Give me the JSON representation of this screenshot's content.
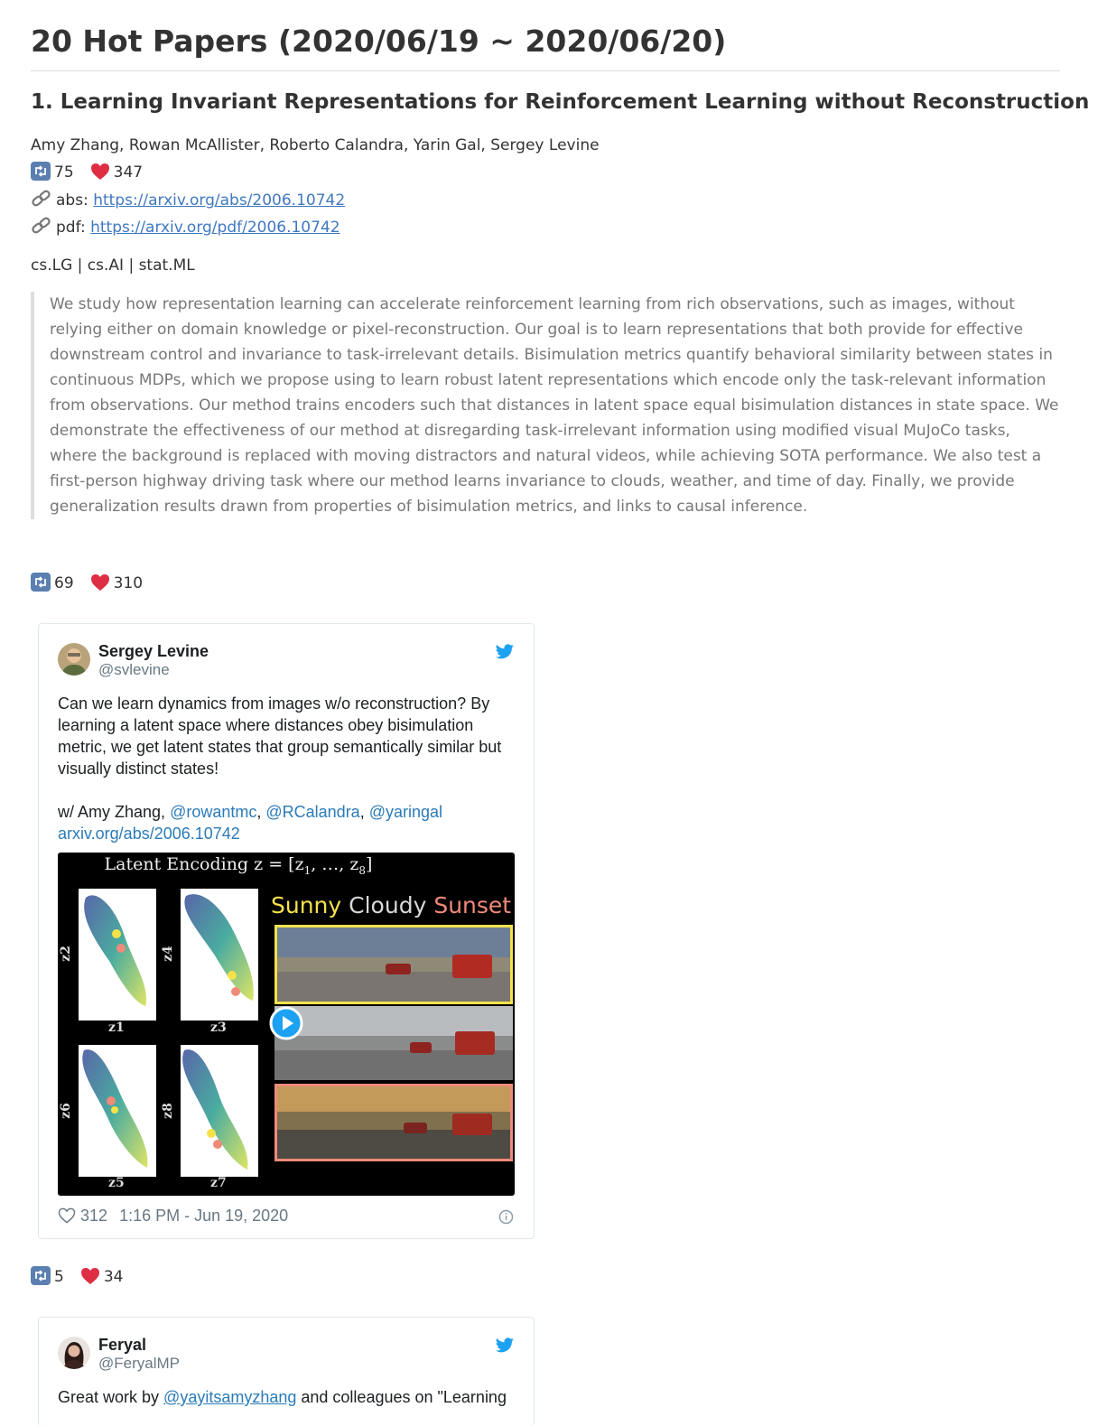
{
  "page_title": "20 Hot Papers (2020/06/19 ~ 2020/06/20)",
  "paper": {
    "title": "1. Learning Invariant Representations for Reinforcement Learning without  Reconstruction",
    "authors": "Amy Zhang, Rowan McAllister, Roberto Calandra, Yarin Gal, Sergey Levine",
    "retweets": "75",
    "likes": "347",
    "abs_label": "abs:",
    "abs_url": "https://arxiv.org/abs/2006.10742",
    "pdf_label": "pdf:",
    "pdf_url": "https://arxiv.org/pdf/2006.10742",
    "categories": "cs.LG | cs.AI | stat.ML",
    "abstract": "We study how representation learning can accelerate reinforcement learning from rich observations, such as images, without relying either on domain knowledge or pixel-reconstruction. Our goal is to learn representations that both provide for effective downstream control and invariance to task-irrelevant details. Bisimulation metrics quantify behavioral similarity between states in continuous MDPs, which we propose using to learn robust latent representations which encode only the task-relevant information from observations. Our method trains encoders such that distances in latent space equal bisimulation distances in state space. We demonstrate the effectiveness of our method at disregarding task-irrelevant information using modified visual MuJoCo tasks, where the background is replaced with moving distractors and natural videos, while achieving SOTA performance. We also test a first-person highway driving task where our method learns invariance to clouds, weather, and time of day. Finally, we provide generalization results drawn from properties of bisimulation metrics, and links to causal inference."
  },
  "tweet1": {
    "retweets": "69",
    "likes": "310",
    "name": "Sergey Levine",
    "handle": "@svlevine",
    "text": "Can we learn dynamics from images w/o reconstruction? By learning a latent space where distances obey bisimulation metric, we get latent states that group semantically similar but visually distinct states!",
    "mention_prefix": "w/ Amy Zhang, ",
    "mention1": "@rowantmc",
    "sep1": ", ",
    "mention2": "@RCalandra",
    "sep2": ", ",
    "mention3": "@yaringal",
    "link": "arxiv.org/abs/2006.10742",
    "media": {
      "title_prefix": "Latent Encoding ",
      "title_math": "z = [z",
      "title_sub1": "1",
      "title_mid": ", …, z",
      "title_sub2": "8",
      "title_end": "]",
      "word_sunny": "Sunny",
      "word_cloudy": "Cloudy",
      "word_sunset": "Sunset",
      "labels": [
        {
          "x": "z1",
          "y": "z2"
        },
        {
          "x": "z3",
          "y": "z4"
        },
        {
          "x": "z5",
          "y": "z6"
        },
        {
          "x": "z7",
          "y": "z8"
        }
      ],
      "colors": {
        "sunny": "#f5e24a",
        "cloudy": "#d8d8d8",
        "sunset": "#f08a7a"
      }
    },
    "like_count": "312",
    "timestamp": "1:16 PM - Jun 19, 2020"
  },
  "tweet2": {
    "retweets": "5",
    "likes": "34",
    "name": "Feryal",
    "handle": "@FeryalMP",
    "text_prefix": "Great work by ",
    "mention": "@yayitsamyzhang",
    "text_suffix": " and colleagues on \"Learning"
  },
  "colors": {
    "link": "#4078c0",
    "twitter_link": "#2b7bb9",
    "twitter_blue": "#1da1f2",
    "heart": "#e0245e",
    "retweet_icon": "#5b7fb0"
  }
}
